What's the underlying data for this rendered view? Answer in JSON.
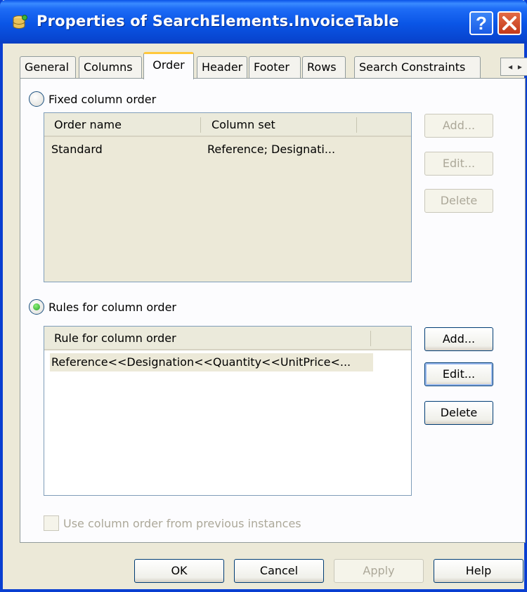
{
  "window": {
    "title": "Properties of SearchElements.InvoiceTable"
  },
  "tabs": [
    {
      "label": "General"
    },
    {
      "label": "Columns"
    },
    {
      "label": "Order"
    },
    {
      "label": "Header"
    },
    {
      "label": "Footer"
    },
    {
      "label": "Rows"
    },
    {
      "label": "Search Constraints"
    }
  ],
  "active_tab": "Order",
  "fixed_order": {
    "radio_label": "Fixed column order",
    "selected": false,
    "columns": [
      "Order name",
      "Column set"
    ],
    "rows": [
      {
        "name": "Standard",
        "column_set": "Reference; Designati..."
      }
    ],
    "buttons": {
      "add": "Add...",
      "edit": "Edit...",
      "delete": "Delete"
    }
  },
  "rules_order": {
    "radio_label": "Rules for column order",
    "selected": true,
    "columns": [
      "Rule for column order"
    ],
    "rows": [
      {
        "rule": "Reference<<Designation<<Quantity<<UnitPrice<..."
      }
    ],
    "buttons": {
      "add": "Add...",
      "edit": "Edit...",
      "delete": "Delete"
    }
  },
  "use_previous": {
    "label": "Use column order from previous instances",
    "checked": false,
    "enabled": false
  },
  "footer_buttons": {
    "ok": "OK",
    "cancel": "Cancel",
    "apply": "Apply",
    "help": "Help"
  },
  "colors": {
    "titlebar": "#0a55e6",
    "active_tab_accent": "#ffc83c",
    "selected_row": "#ece9d8"
  }
}
